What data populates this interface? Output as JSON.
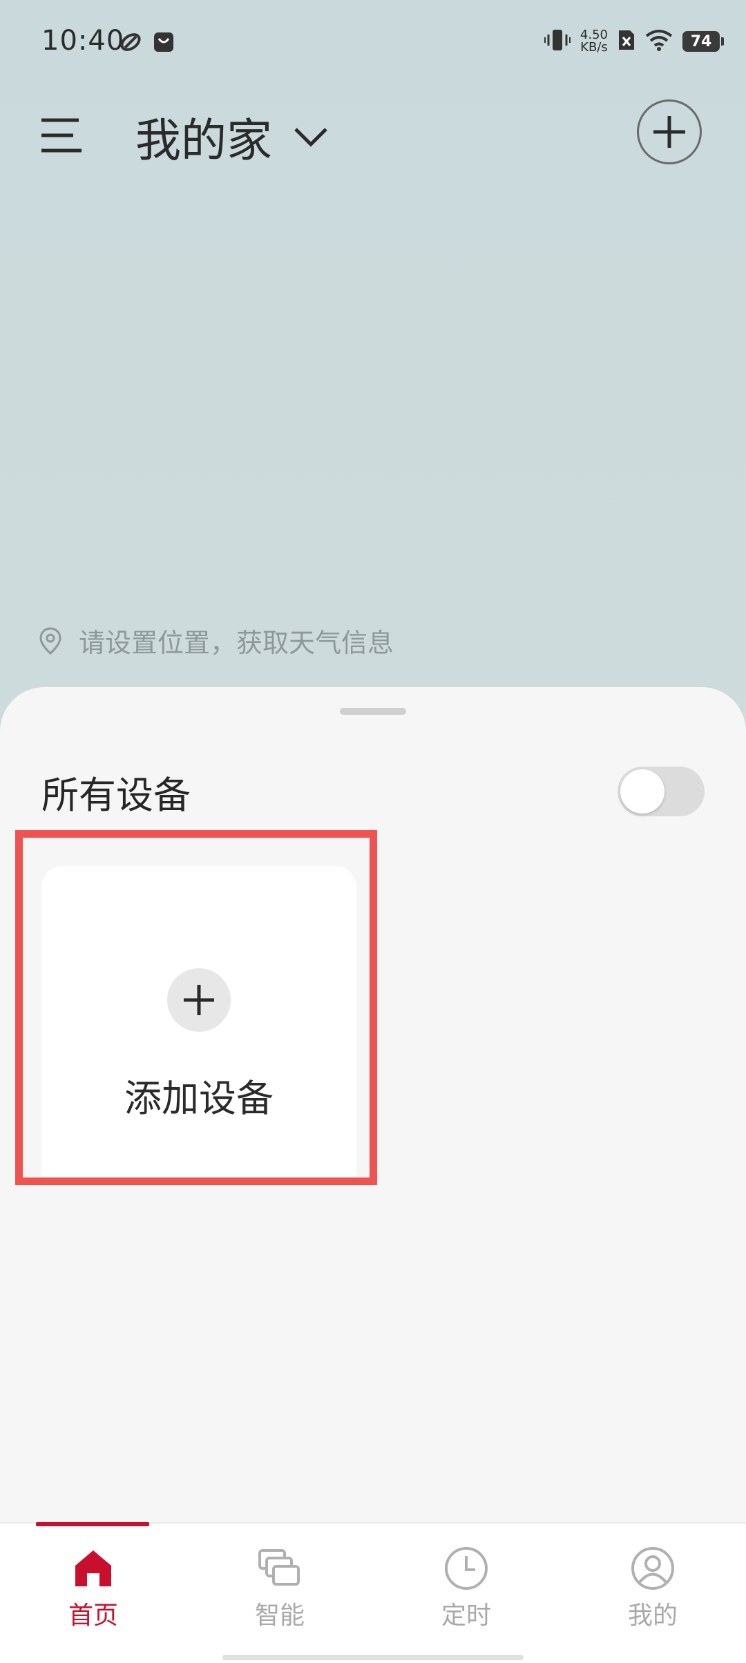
{
  "status_bar": {
    "time": "10:40",
    "net_speed_value": "4.50",
    "net_speed_unit": "KB/s",
    "battery": "74"
  },
  "header": {
    "home_name": "我的家"
  },
  "location": {
    "hint": "请设置位置，获取天气信息"
  },
  "devices": {
    "section_title": "所有设备",
    "toggle_on": false,
    "add_device_label": "添加设备"
  },
  "bottom_nav": {
    "items": [
      {
        "label": "首页",
        "icon": "home-icon",
        "active": true
      },
      {
        "label": "智能",
        "icon": "smart-scenes-icon",
        "active": false
      },
      {
        "label": "定时",
        "icon": "clock-icon",
        "active": false
      },
      {
        "label": "我的",
        "icon": "profile-icon",
        "active": false
      }
    ]
  },
  "colors": {
    "accent": "#c8102e",
    "highlight_border": "#ef5350",
    "header_bg": "#cad9db"
  }
}
